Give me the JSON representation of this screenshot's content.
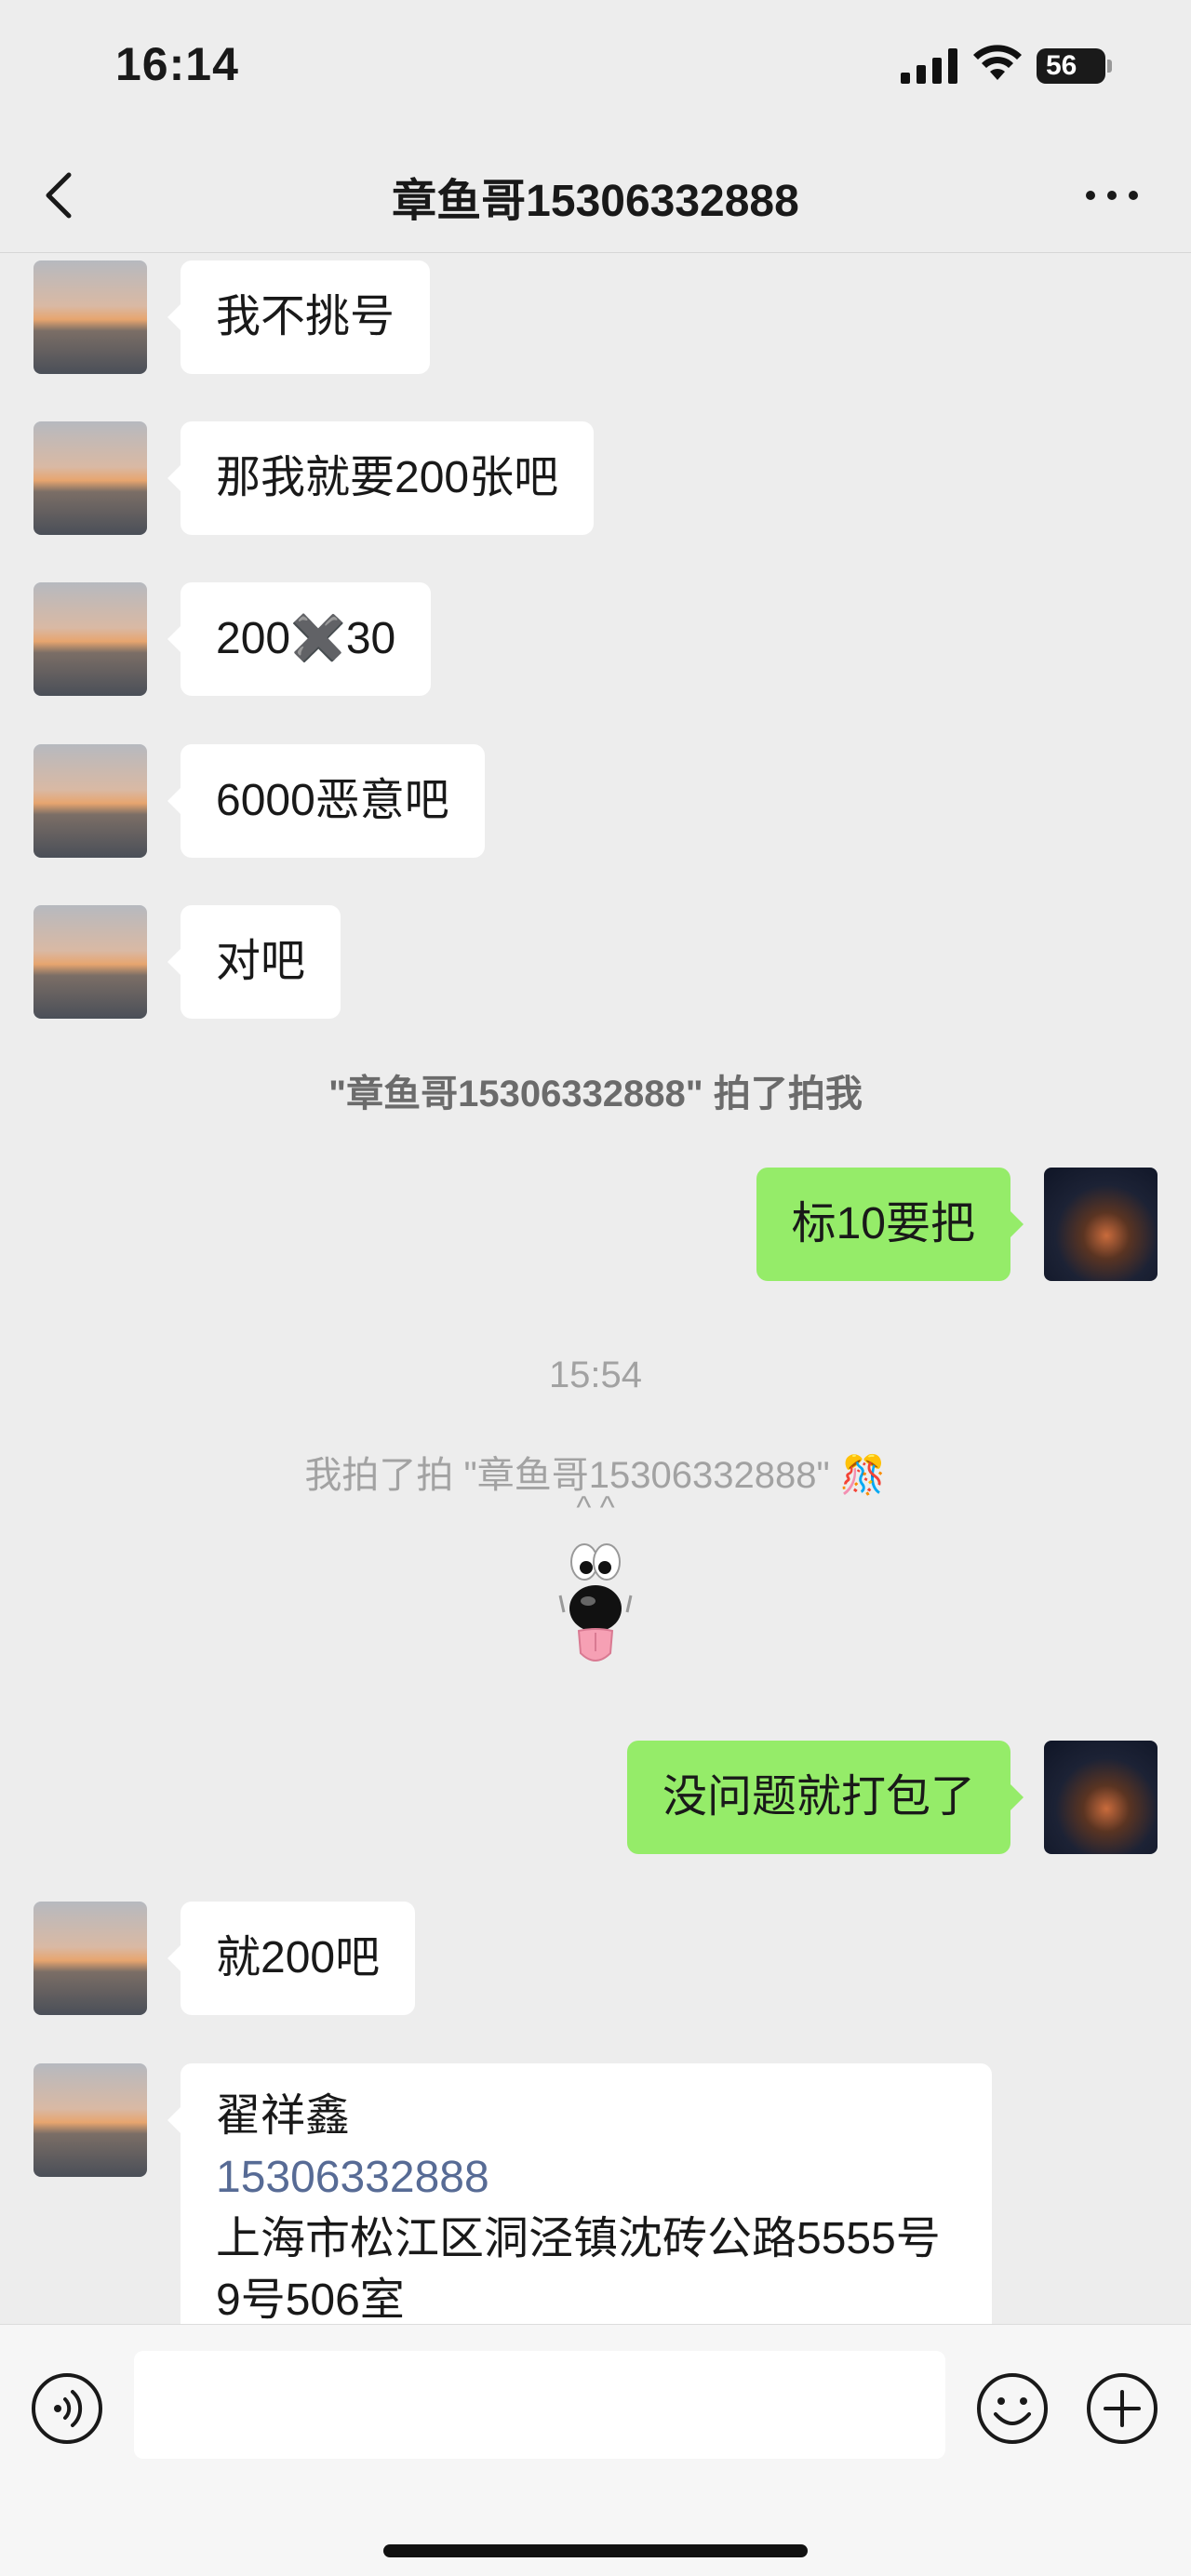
{
  "status_bar": {
    "time": "16:14",
    "battery": "56"
  },
  "header": {
    "title": "章鱼哥15306332888"
  },
  "messages": [
    {
      "text": "我不挑号"
    },
    {
      "text": "那我就要200张吧"
    },
    {
      "text": "200✖️30"
    },
    {
      "text": "6000恶意吧"
    },
    {
      "text": "对吧"
    },
    {
      "text": "\"章鱼哥15306332888\" 拍了拍我"
    },
    {
      "text": "标10要把"
    },
    {
      "text": "15:54"
    },
    {
      "text": "我拍了拍 \"章鱼哥15306332888\" 🎊"
    },
    {
      "text": "^ ^"
    },
    {
      "text": "没问题就打包了"
    },
    {
      "text": "就200吧"
    },
    {
      "name": "翟祥鑫",
      "phone": "15306332888",
      "address": "上海市松江区洞泾镇沈砖公路5555号9号506室"
    }
  ],
  "input_bar": {
    "placeholder": ""
  }
}
